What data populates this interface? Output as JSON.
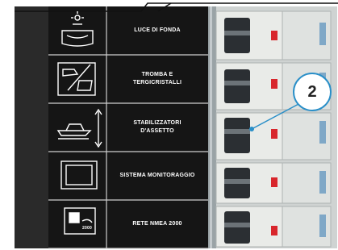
{
  "panel": {
    "labels": [
      "LUCE DI FONDA",
      "TROMBA E\nTERGICRISTALLI",
      "STABILIZZATORI\nD'ASSETTO",
      "SISTEMA MONITORAGGIO",
      "RETE NMEA 2000"
    ],
    "nmea_icon_text": "2000"
  },
  "callout": {
    "number": "2"
  },
  "colors": {
    "panel_black": "#1a1a1a",
    "frame_blue": "#2a8fc8",
    "breaker_red": "#d8262c",
    "breaker_white": "#e9ebe8"
  }
}
